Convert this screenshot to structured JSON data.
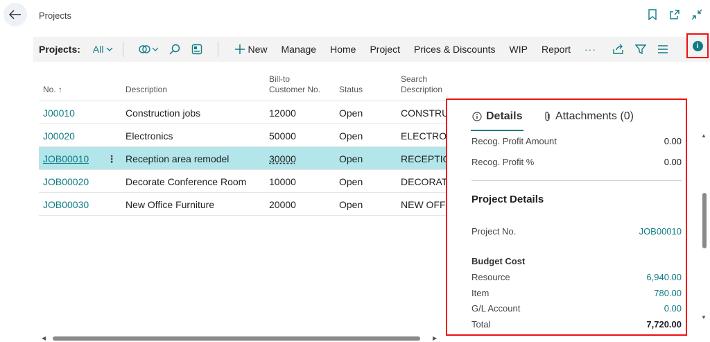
{
  "header": {
    "title": "Projects"
  },
  "actionbar": {
    "label": "Projects:",
    "view": "All",
    "new_label": "New",
    "items": [
      "Manage",
      "Home",
      "Project",
      "Prices & Discounts",
      "WIP",
      "Report"
    ],
    "more": "···"
  },
  "table": {
    "headers": {
      "no": "No. ↑",
      "description": "Description",
      "bill_to_1": "Bill-to",
      "bill_to_2": "Customer No.",
      "status": "Status",
      "search_1": "Search",
      "search_2": "Description"
    },
    "rows": [
      {
        "no": "J00010",
        "description": "Construction jobs",
        "bill_to": "12000",
        "status": "Open",
        "search": "CONSTRUCTION JOBS"
      },
      {
        "no": "J00020",
        "description": "Electronics",
        "bill_to": "50000",
        "status": "Open",
        "search": "ELECTRONICS"
      },
      {
        "no": "JOB00010",
        "description": "Reception area remodel",
        "bill_to": "30000",
        "status": "Open",
        "search": "RECEPTION AREA REMODEL"
      },
      {
        "no": "JOB00020",
        "description": "Decorate Conference Room",
        "bill_to": "10000",
        "status": "Open",
        "search": "DECORATE CONFERENCE ROOM"
      },
      {
        "no": "JOB00030",
        "description": "New Office Furniture",
        "bill_to": "20000",
        "status": "Open",
        "search": "NEW OFFICE FURNITURE"
      }
    ],
    "selected_index": 2
  },
  "factbox": {
    "tab_details": "Details",
    "tab_attachments": "Attachments (0)",
    "recog_profit_amount_label": "Recog. Profit Amount",
    "recog_profit_amount": "0.00",
    "recog_profit_pct_label": "Recog. Profit %",
    "recog_profit_pct": "0.00",
    "section_title": "Project Details",
    "project_no_label": "Project No.",
    "project_no": "JOB00010",
    "budget_cost_label": "Budget Cost",
    "resource_label": "Resource",
    "resource": "6,940.00",
    "item_label": "Item",
    "item": "780.00",
    "gl_label": "G/L Account",
    "gl": "0.00",
    "total_label": "Total",
    "total": "7,720.00"
  },
  "colors": {
    "accent": "#0f7c85",
    "selected_row": "#b2e6ea",
    "highlight_box": "#ee1111"
  }
}
